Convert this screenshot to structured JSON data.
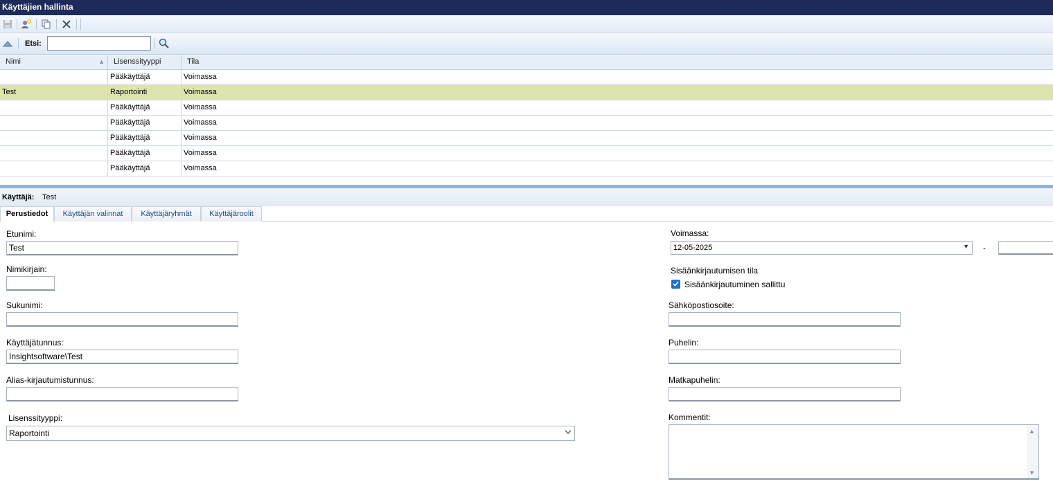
{
  "window": {
    "title": "Käyttäjien hallinta"
  },
  "toolbar": {
    "buttons": [
      "save-icon",
      "add-user-icon",
      "copy-icon",
      "delete-icon"
    ]
  },
  "search": {
    "label": "Etsi:",
    "value": "",
    "placeholder": ""
  },
  "grid": {
    "columns": [
      "Nimi",
      "Lisenssityyppi",
      "Tila"
    ],
    "rows": [
      {
        "name": "",
        "license": "Pääkäyttäjä",
        "status": "Voimassa",
        "selected": false
      },
      {
        "name": "Test",
        "license": "Raportointi",
        "status": "Voimassa",
        "selected": true
      },
      {
        "name": "",
        "license": "Pääkäyttäjä",
        "status": "Voimassa",
        "selected": false
      },
      {
        "name": "",
        "license": "Pääkäyttäjä",
        "status": "Voimassa",
        "selected": false
      },
      {
        "name": "",
        "license": "Pääkäyttäjä",
        "status": "Voimassa",
        "selected": false
      },
      {
        "name": "",
        "license": "Pääkäyttäjä",
        "status": "Voimassa",
        "selected": false
      },
      {
        "name": "",
        "license": "Pääkäyttäjä",
        "status": "Voimassa",
        "selected": false
      }
    ],
    "selected_color": "#dfe3ae"
  },
  "userbar": {
    "label": "Käyttäjä:",
    "value": "Test"
  },
  "tabs": [
    "Perustiedot",
    "Käyttäjän valinnat",
    "Käyttäjäryhmät",
    "Käyttäjäroolit"
  ],
  "form": {
    "first_name": {
      "label": "Etunimi:",
      "value": "Test"
    },
    "initials": {
      "label": "Nimikirjain:",
      "value": ""
    },
    "last_name": {
      "label": "Sukunimi:",
      "value": ""
    },
    "username": {
      "label": "Käyttäjätunnus:",
      "value": "Insightsoftware\\Test"
    },
    "alias": {
      "label": "Alias-kirjautumistunnus:",
      "value": ""
    },
    "license": {
      "label": "Lisenssityyppi:",
      "value": "Raportointi"
    },
    "valid": {
      "label": "Voimassa:",
      "from": "12-05-2025",
      "separator": "-",
      "to": ""
    },
    "login_state": {
      "label": "Sisäänkirjautumisen tila",
      "checkbox_label": "Sisäänkirjautuminen sallittu",
      "checked": true
    },
    "email": {
      "label": "Sähköpostiosoite:",
      "value": ""
    },
    "phone": {
      "label": "Puhelin:",
      "value": ""
    },
    "mobile": {
      "label": "Matkapuhelin:",
      "value": ""
    },
    "comments": {
      "label": "Kommentit:",
      "value": ""
    }
  },
  "colors": {
    "title_bar": "#1e2a5a",
    "checkbox": "#1f6fd1",
    "tab_text": "#1c4f8f"
  }
}
